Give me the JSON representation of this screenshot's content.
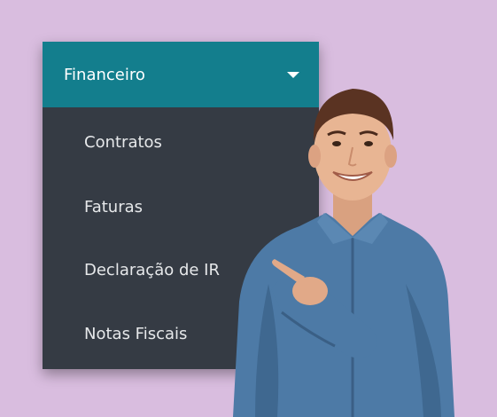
{
  "menu": {
    "title": "Financeiro",
    "items": [
      {
        "label": "Contratos"
      },
      {
        "label": "Faturas"
      },
      {
        "label": "Declaração de IR"
      },
      {
        "label": "Notas Fiscais"
      }
    ]
  },
  "colors": {
    "background": "#d9bddf",
    "header": "#137e8d",
    "menu_body": "#353b44",
    "item_text": "#e6e8ea"
  },
  "icons": {
    "dropdown": "caret-down-icon"
  }
}
